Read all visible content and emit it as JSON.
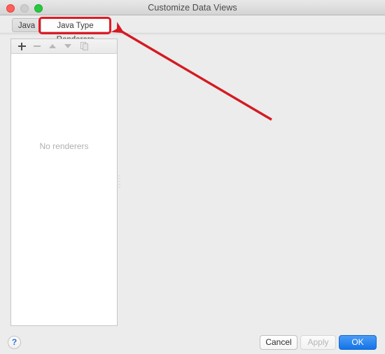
{
  "window": {
    "title": "Customize Data Views",
    "controls": {
      "close": "close-button",
      "minimize": "minimize-button",
      "maximize": "maximize-button"
    }
  },
  "tabs": [
    {
      "label": "Java",
      "selected": false
    },
    {
      "label": "Java Type Renderers",
      "selected": true
    }
  ],
  "list_panel": {
    "toolbar": [
      {
        "name": "add",
        "glyph": "plus-icon",
        "enabled": true
      },
      {
        "name": "remove",
        "glyph": "minus-icon",
        "enabled": false
      },
      {
        "name": "move-up",
        "glyph": "triangle-up-icon",
        "enabled": false
      },
      {
        "name": "move-down",
        "glyph": "triangle-down-icon",
        "enabled": false
      },
      {
        "name": "duplicate",
        "glyph": "copy-icon",
        "enabled": false
      }
    ],
    "empty_message": "No renderers"
  },
  "footer": {
    "help_label": "?",
    "cancel_label": "Cancel",
    "apply_label": "Apply",
    "apply_enabled": false,
    "ok_label": "OK",
    "ok_is_default": true
  },
  "annotations": {
    "highlight_target": "Java Type Renderers",
    "arrow_color": "#e01b24",
    "highlight_color": "#e01b24"
  },
  "colors": {
    "window_background": "#ececec",
    "panel_background": "#ffffff",
    "titlebar_top": "#e8e8e8",
    "titlebar_bottom": "#d4d4d4",
    "accent_blue": "#1374e8",
    "close_red": "#ff5f57",
    "minimize_gray": "#cdcdcd",
    "maximize_green": "#28c840",
    "empty_text": "#b0b0b0"
  }
}
